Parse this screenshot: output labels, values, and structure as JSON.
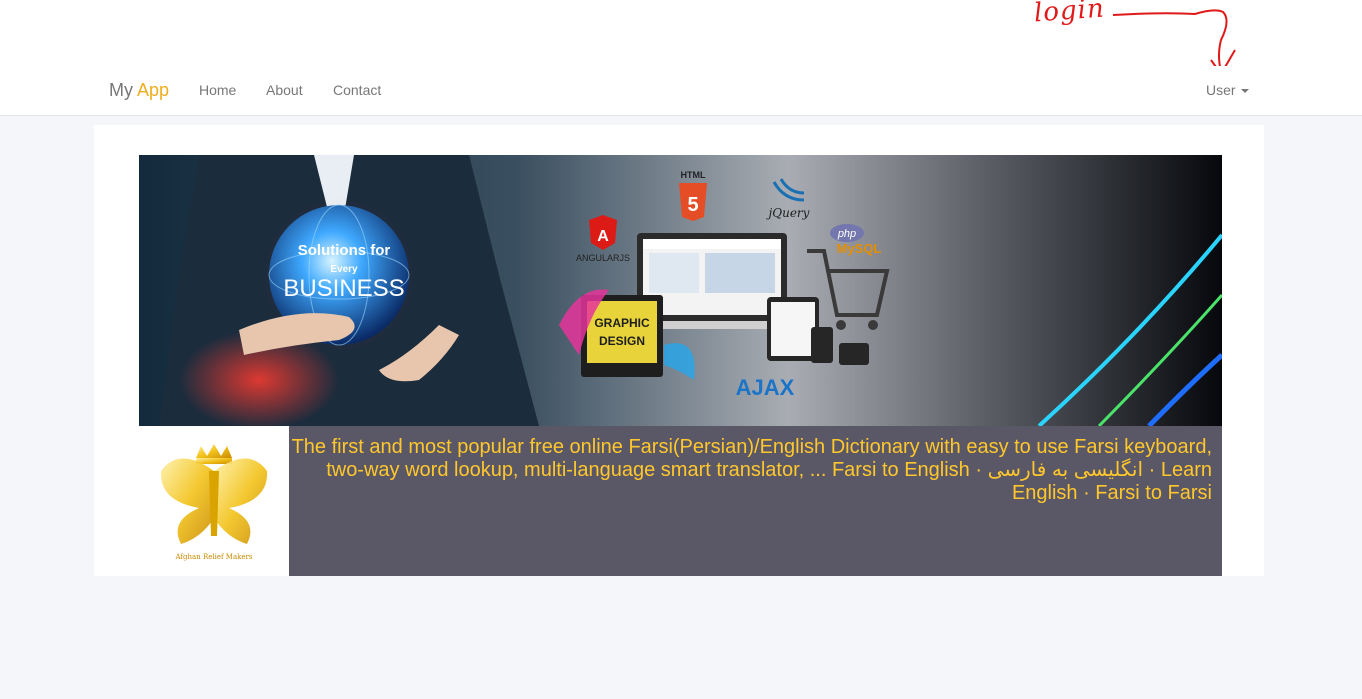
{
  "annotation": {
    "text": "login"
  },
  "navbar": {
    "brand_main": "My",
    "brand_accent": "App",
    "links": [
      "Home",
      "About",
      "Contact"
    ],
    "user_menu": "User"
  },
  "banner": {
    "headline_top": "Solutions for",
    "headline_mid": "Every",
    "headline_main": "BUSINESS",
    "tech_html": "HTML",
    "tech_html_num": "5",
    "tech_jquery": "jQuery",
    "tech_angular": "ANGULARJS",
    "tech_php": "php",
    "tech_mysql": "MySQL",
    "tech_graphic": "GRAPHIC",
    "tech_design": "DESIGN",
    "tech_ajax": "AJAX"
  },
  "logo": {
    "caption": "Afghan Relief Makers"
  },
  "description": "The first and most popular free online Farsi(Persian)/English Dictionary with easy to use Farsi keyboard, two-way word lookup, multi-language smart translator, ... Farsi to English · انگلیسی به فارسی · Learn English · Farsi to Farsi",
  "colors": {
    "brand_accent": "#f0ad1c",
    "description_text": "#ffc72c",
    "info_background": "#5a5867",
    "annotation": "#e01a1a"
  }
}
